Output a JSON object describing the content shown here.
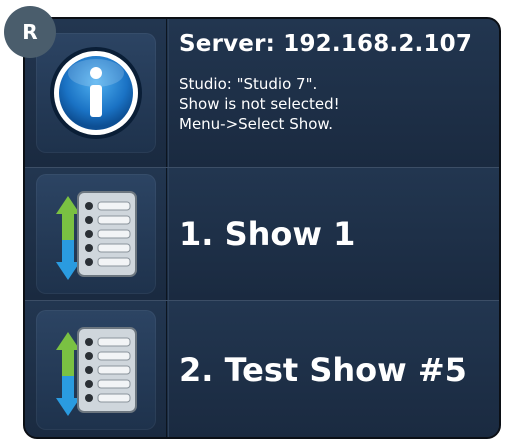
{
  "badge": {
    "letter": "R"
  },
  "server": {
    "title": "Server: 192.168.2.107",
    "lines": [
      "Studio: \"Studio 7\".",
      "Show is not selected!",
      "Menu->Select Show."
    ],
    "icon": "info-icon"
  },
  "shows": [
    {
      "label": "1. Show 1",
      "icon": "show-list-icon"
    },
    {
      "label": "2. Test Show #5",
      "icon": "show-list-icon"
    }
  ],
  "colors": {
    "background": "#1b2a3c",
    "text": "#ffffff",
    "badge": "#4a5d6c",
    "info_blue": "#1a7fd0",
    "arrow_green": "#7ac142",
    "arrow_blue": "#2a9be0"
  }
}
